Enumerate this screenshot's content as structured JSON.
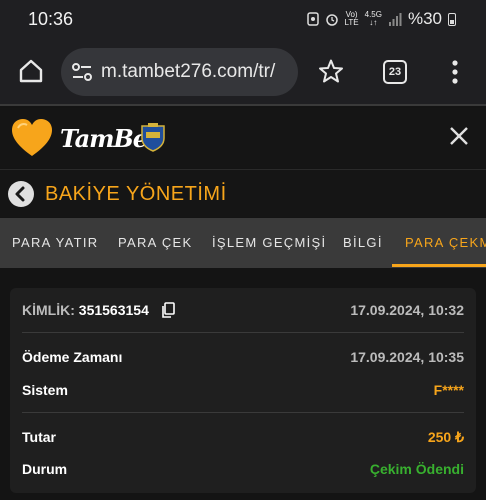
{
  "status_bar": {
    "time": "10:36",
    "network_top": "Vo)",
    "network_bottom": "LTE",
    "signal_top": "4.5G",
    "battery_percent": "%30"
  },
  "browser": {
    "url": "m.tambet276.com/tr/",
    "tab_count": "23"
  },
  "site": {
    "brand": "TamBet"
  },
  "page": {
    "title": "BAKİYE YÖNETİMİ"
  },
  "tabs": [
    {
      "label": "PARA YATIR",
      "active": false
    },
    {
      "label": "PARA ÇEK",
      "active": false
    },
    {
      "label": "İŞLEM GEÇMİŞİ",
      "active": false
    },
    {
      "label": "BİLGİ",
      "active": false
    },
    {
      "label": "PARA ÇEKM",
      "active": true
    }
  ],
  "transaction": {
    "id_label": "KİMLİK:",
    "id_value": "351563154",
    "created_at": "17.09.2024, 10:32",
    "payment_time_label": "Ödeme Zamanı",
    "payment_time_value": "17.09.2024, 10:35",
    "system_label": "Sistem",
    "system_value": "F****",
    "amount_label": "Tutar",
    "amount_value": "250 ₺",
    "status_label": "Durum",
    "status_value": "Çekim Ödendi"
  },
  "colors": {
    "accent": "#f7a51b",
    "success": "#38b02f",
    "background": "#141414"
  }
}
